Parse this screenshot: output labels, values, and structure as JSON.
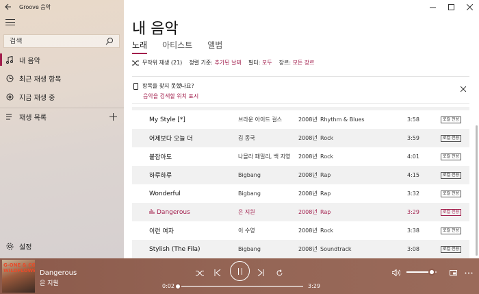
{
  "app": {
    "title": "Groove 음악"
  },
  "sidebar": {
    "search_placeholder": "검색",
    "items": [
      {
        "label": "내 음악",
        "icon": "music-note-icon",
        "active": true
      },
      {
        "label": "최근 재생 항목",
        "icon": "clock-icon"
      },
      {
        "label": "지금 재생 중",
        "icon": "now-playing-icon"
      }
    ],
    "playlists_label": "재생 목록",
    "settings_label": "설정"
  },
  "main": {
    "page_title": "내 음악",
    "tabs": [
      {
        "label": "노래",
        "active": true
      },
      {
        "label": "아티스트"
      },
      {
        "label": "앨범"
      }
    ],
    "toolbar": {
      "shuffle_label": "무작위 재생 (21)",
      "sort_prefix": "정렬 기준:",
      "sort_value": "추가된 날짜",
      "filter_prefix": "필터:",
      "filter_value": "모두",
      "genre_prefix": "장르:",
      "genre_value": "모든 장르"
    },
    "notice": {
      "text": "항목을 찾지 못했나요?",
      "link": "음악을 검색할 위치 표시"
    },
    "songs": [
      {
        "title": "My Style [*]",
        "artist": "브라운 아이드 걸스",
        "year": "2008년",
        "genre": "Rhythm & Blues",
        "duration": "3:58",
        "badge": "로컬 전용"
      },
      {
        "title": "어제보다 오늘 더",
        "artist": "김 종국",
        "year": "2008년",
        "genre": "Rock",
        "duration": "3:59",
        "badge": "로컬 전용"
      },
      {
        "title": "붙잡아도",
        "artist": "나몰라 패밀리, 백 지영",
        "year": "2008년",
        "genre": "Rock",
        "duration": "4:01",
        "badge": "로컬 전용"
      },
      {
        "title": "하루하루",
        "artist": "Bigbang",
        "year": "2008년",
        "genre": "Rap",
        "duration": "4:15",
        "badge": "로컬 전용"
      },
      {
        "title": "Wonderful",
        "artist": "Bigbang",
        "year": "2008년",
        "genre": "Rap",
        "duration": "3:32",
        "badge": "로컬 전용"
      },
      {
        "title": "Dangerous",
        "artist": "은 지원",
        "year": "2008년",
        "genre": "Rap",
        "duration": "3:29",
        "badge": "로컬 전용",
        "playing": true
      },
      {
        "title": "이런 여자",
        "artist": "이 수영",
        "year": "2008년",
        "genre": "Rock",
        "duration": "3:38",
        "badge": "로컬 전용"
      },
      {
        "title": "Stylish (The Fila)",
        "artist": "Bigbang",
        "year": "2008년",
        "genre": "Soundtrack",
        "duration": "3:08",
        "badge": "로컬 전용"
      }
    ]
  },
  "player": {
    "title": "Dangerous",
    "artist": "은 지원",
    "album_art_text": "G-ONE & CODE WILDFLOWERS",
    "elapsed": "0:02",
    "total": "3:29",
    "progress_fraction": 0.01,
    "volume_fraction": 0.85
  },
  "colors": {
    "accent": "#a21e4c",
    "player_bg": "#946555"
  }
}
